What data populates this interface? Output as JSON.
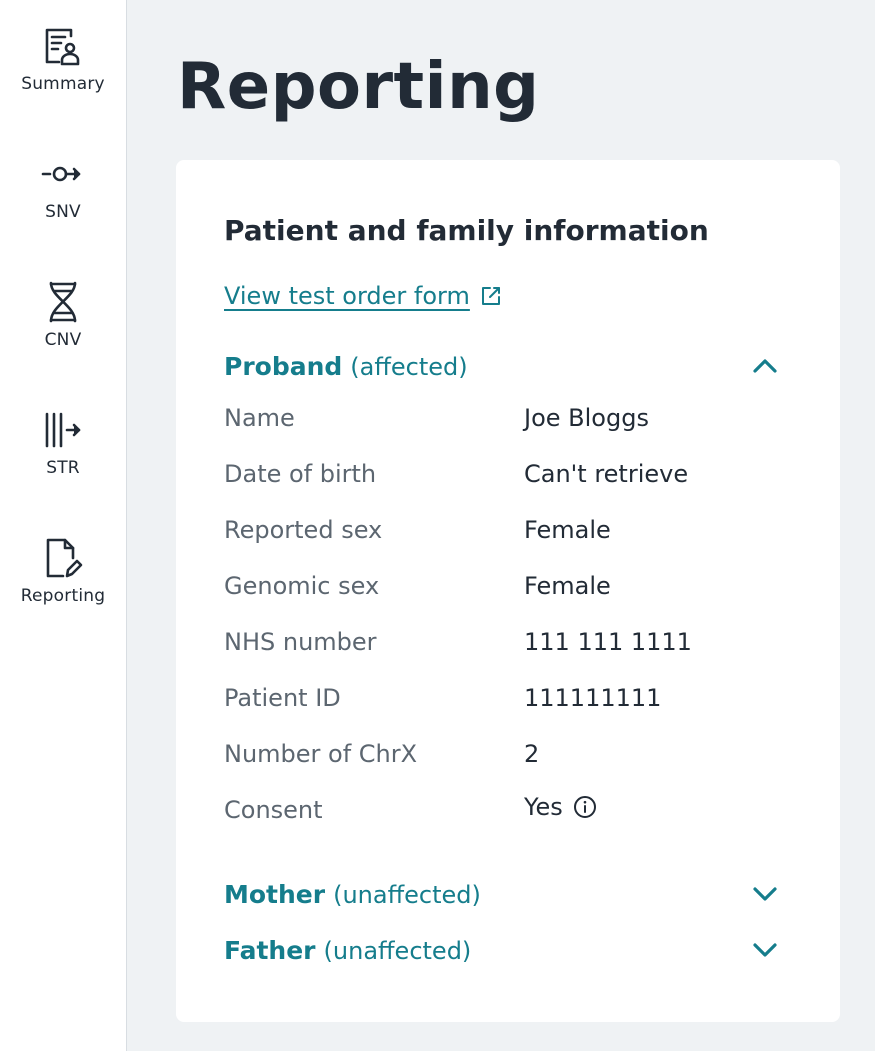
{
  "sidebar": {
    "items": [
      {
        "label": "Summary",
        "icon": "summary-report-icon"
      },
      {
        "label": "SNV",
        "icon": "snv-variant-icon"
      },
      {
        "label": "CNV",
        "icon": "dna-helix-icon"
      },
      {
        "label": "STR",
        "icon": "str-repeat-icon"
      },
      {
        "label": "Reporting",
        "icon": "document-edit-icon"
      }
    ]
  },
  "page": {
    "title": "Reporting"
  },
  "card": {
    "title": "Patient and family information",
    "order_link": "View test order form",
    "proband": {
      "name": "Proband",
      "status": "(affected)",
      "fields": [
        {
          "label": "Name",
          "value": "Joe Bloggs"
        },
        {
          "label": "Date of birth",
          "value": "Can't retrieve"
        },
        {
          "label": "Reported sex",
          "value": "Female"
        },
        {
          "label": "Genomic sex",
          "value": "Female"
        },
        {
          "label": "NHS number",
          "value": "111 111 1111"
        },
        {
          "label": "Patient ID",
          "value": "111111111"
        },
        {
          "label": "Number of ChrX",
          "value": "2"
        },
        {
          "label": "Consent",
          "value": "Yes"
        }
      ]
    },
    "mother": {
      "name": "Mother",
      "status": "(unaffected)"
    },
    "father": {
      "name": "Father",
      "status": "(unaffected)"
    }
  },
  "colors": {
    "accent": "#157d8c",
    "text": "#222b36",
    "muted": "#5c6670",
    "background": "#eff2f4"
  }
}
